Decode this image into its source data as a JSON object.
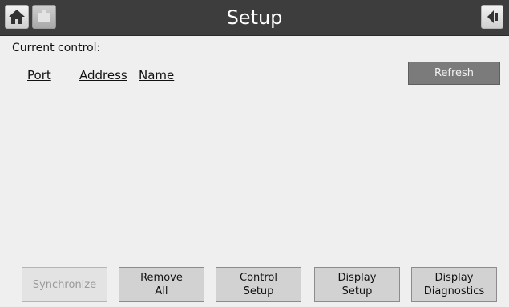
{
  "header": {
    "title": "Setup",
    "icons": [
      "home-icon",
      "status-icon",
      "back-icon"
    ]
  },
  "main": {
    "current_control_label": "Current control:",
    "columns": [
      "Port",
      "Address",
      "Name"
    ],
    "refresh_label": "Refresh"
  },
  "footer": {
    "buttons": [
      {
        "label": "Synchronize",
        "enabled": false
      },
      {
        "label": "Remove\nAll",
        "enabled": true
      },
      {
        "label": "Control\nSetup",
        "enabled": true
      },
      {
        "label": "Display\nSetup",
        "enabled": true
      },
      {
        "label": "Display\nDiagnostics",
        "enabled": true
      }
    ]
  },
  "colors": {
    "titlebar": "#3d3d3d",
    "background": "#efefef",
    "refresh_button": "#7b7b7b",
    "button": "#d2d2d2",
    "disabled_text": "#9a9a9a"
  }
}
